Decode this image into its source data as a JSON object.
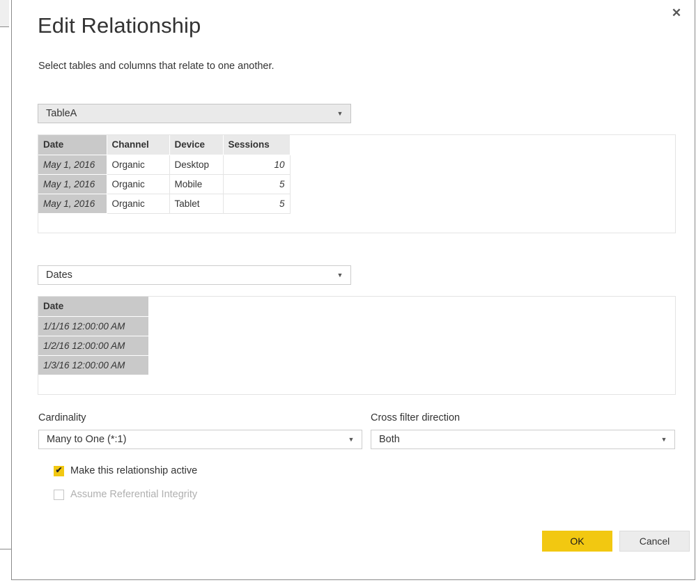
{
  "dialog": {
    "title": "Edit Relationship",
    "subtitle": "Select tables and columns that relate to one another.",
    "close_label": "✕"
  },
  "colors": {
    "accent": "#F2C811",
    "selection": "#C9C9C9",
    "header": "#E9E9E9",
    "border": "#CCCCCC",
    "text": "#333333",
    "disabled_text": "#B0B0B0"
  },
  "table_a": {
    "dropdown_value": "TableA",
    "caret": "▼",
    "selected_column": "Date",
    "columns": [
      "Date",
      "Channel",
      "Device",
      "Sessions"
    ],
    "rows": [
      [
        "May 1, 2016",
        "Organic",
        "Desktop",
        "10"
      ],
      [
        "May 1, 2016",
        "Organic",
        "Mobile",
        "5"
      ],
      [
        "May 1, 2016",
        "Organic",
        "Tablet",
        "5"
      ]
    ]
  },
  "table_b": {
    "dropdown_value": "Dates",
    "caret": "▼",
    "selected_column": "Date",
    "columns": [
      "Date"
    ],
    "rows": [
      [
        "1/1/16 12:00:00 AM"
      ],
      [
        "1/2/16 12:00:00 AM"
      ],
      [
        "1/3/16 12:00:00 AM"
      ]
    ]
  },
  "cardinality": {
    "label": "Cardinality",
    "value": "Many to One (*:1)",
    "caret": "▼"
  },
  "cross_filter": {
    "label": "Cross filter direction",
    "value": "Both",
    "caret": "▼"
  },
  "options": {
    "active": {
      "label": "Make this relationship active",
      "checked": true,
      "tick": "✔"
    },
    "referential_integrity": {
      "label": "Assume Referential Integrity",
      "checked": false,
      "disabled": true
    }
  },
  "footer": {
    "ok_label": "OK",
    "cancel_label": "Cancel"
  }
}
